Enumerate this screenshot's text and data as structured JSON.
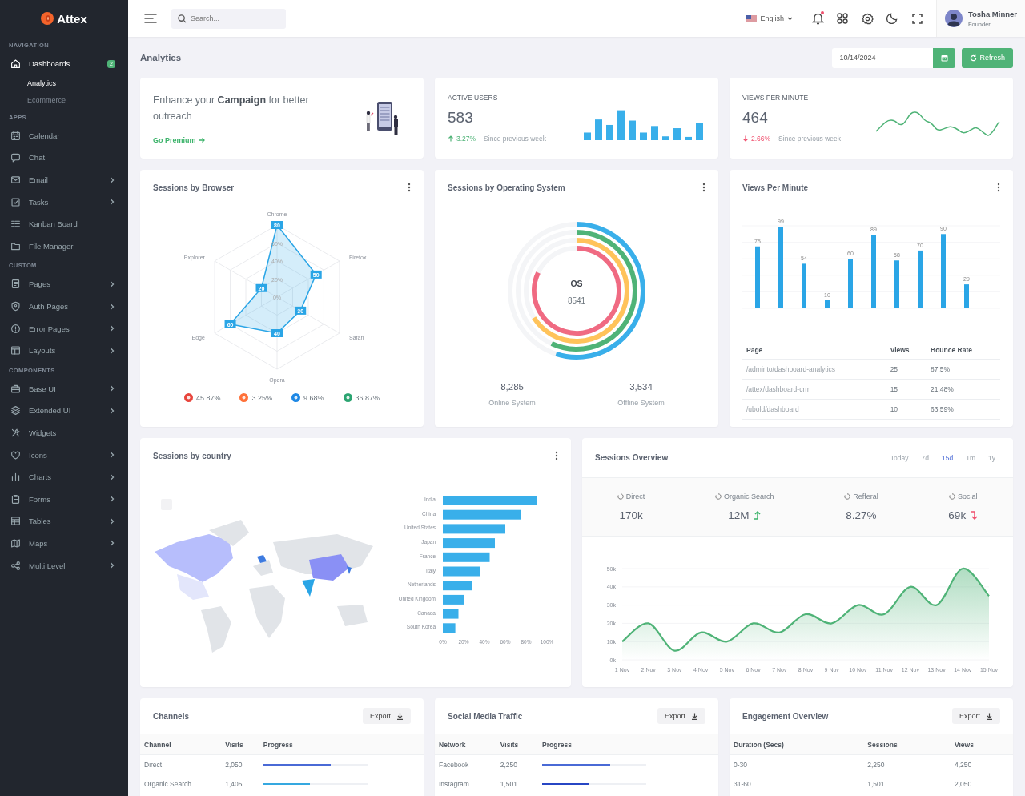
{
  "brand": {
    "name": "Attex"
  },
  "sidebar": {
    "sections": [
      {
        "title": "NAVIGATION",
        "items": [
          {
            "label": "Dashboards",
            "kind": "menu",
            "expanded": true,
            "badge": "2",
            "children": [
              {
                "label": "Analytics",
                "selected": true
              },
              {
                "label": "Ecommerce",
                "selected": false
              }
            ]
          }
        ]
      },
      {
        "title": "APPS",
        "items": [
          {
            "label": "Calendar",
            "kind": "link"
          },
          {
            "label": "Chat",
            "kind": "link"
          },
          {
            "label": "Email",
            "kind": "menu",
            "expanded": false
          },
          {
            "label": "Tasks",
            "kind": "menu",
            "expanded": false
          },
          {
            "label": "Kanban Board",
            "kind": "link"
          },
          {
            "label": "File Manager",
            "kind": "link"
          }
        ]
      },
      {
        "title": "CUSTOM",
        "items": [
          {
            "label": "Pages",
            "kind": "menu",
            "expanded": false
          },
          {
            "label": "Auth Pages",
            "kind": "menu",
            "expanded": false
          },
          {
            "label": "Error Pages",
            "kind": "menu",
            "expanded": false
          },
          {
            "label": "Layouts",
            "kind": "menu",
            "expanded": false
          }
        ]
      },
      {
        "title": "COMPONENTS",
        "items": [
          {
            "label": "Base UI",
            "kind": "menu",
            "expanded": false
          },
          {
            "label": "Extended UI",
            "kind": "menu",
            "expanded": false
          },
          {
            "label": "Widgets",
            "kind": "link"
          },
          {
            "label": "Icons",
            "kind": "menu",
            "expanded": false
          },
          {
            "label": "Charts",
            "kind": "menu",
            "expanded": false
          },
          {
            "label": "Forms",
            "kind": "menu",
            "expanded": false
          },
          {
            "label": "Tables",
            "kind": "menu",
            "expanded": false
          },
          {
            "label": "Maps",
            "kind": "menu",
            "expanded": false
          },
          {
            "label": "Multi Level",
            "kind": "menu",
            "expanded": false
          }
        ]
      }
    ]
  },
  "topbar": {
    "search": {
      "placeholder": "Search..."
    },
    "language": "English",
    "notifications": {
      "unread": true
    },
    "user": {
      "name": "Tosha Minner",
      "role": "Founder"
    }
  },
  "page": {
    "title": "Analytics",
    "date": "10/14/2024",
    "refresh": "Refresh"
  },
  "promo": {
    "text": "Enhance your **Campaign** for better outreach",
    "link": "Go Premium"
  },
  "stats": [
    {
      "kind": "bars",
      "title": "ACTIVE USERS",
      "value": "583",
      "change": "3.27%",
      "rising": true,
      "note": "Since previous week"
    },
    {
      "kind": "wave",
      "title": "VIEWS PER MINUTE",
      "value": "464",
      "change": "2.66%",
      "rising": false,
      "note": "Since previous week"
    }
  ],
  "browser_card": {
    "title": "Sessions by Browser",
    "radar": {
      "axes": [
        {
          "label": "Chrome",
          "value": "80"
        },
        {
          "label": "Explorer",
          "value": "20"
        },
        {
          "label": "Firefox",
          "value": "50"
        },
        {
          "label": "Edge",
          "value": "60"
        },
        {
          "label": "Safari",
          "value": "30"
        },
        {
          "label": "Opera",
          "value": "40"
        }
      ],
      "ticks": [
        "60%",
        "40%",
        "20%",
        "0%"
      ]
    },
    "legend": [
      {
        "value": "45.87%",
        "color": "#e8453c"
      },
      {
        "value": "3.25%",
        "color": "#ff7139"
      },
      {
        "value": "9.68%",
        "color": "#1e88e5"
      },
      {
        "value": "36.87%",
        "color": "#2ba471"
      }
    ]
  },
  "os_card": {
    "title": "Sessions by Operating System",
    "center_label": "OS",
    "center_value": "8541",
    "totals": [
      {
        "value": "8,285",
        "label": "Online System"
      },
      {
        "value": "3,534",
        "label": "Offline System"
      }
    ]
  },
  "views_card": {
    "title": "Views Per Minute",
    "bar_labels": [
      "75",
      "99",
      "54",
      "10",
      "60",
      "89",
      "58",
      "70",
      "90",
      "29"
    ],
    "table": {
      "columns": [
        "Page",
        "Views",
        "Bounce Rate"
      ],
      "rows": [
        [
          "/adminto/dashboard-analytics",
          "25",
          "87.5%"
        ],
        [
          "/attex/dashboard-crm",
          "15",
          "21.48%"
        ],
        [
          "/ubold/dashboard",
          "10",
          "63.59%"
        ]
      ]
    }
  },
  "country_card": {
    "title": "Sessions by country",
    "zoom_out": "-",
    "chart_data": {
      "type": "bar",
      "orientation": "horizontal",
      "categories": [
        "India",
        "China",
        "United States",
        "Japan",
        "France",
        "Italy",
        "Netherlands",
        "United Kingdom",
        "Canada",
        "South Korea"
      ],
      "values": [
        90,
        75,
        60,
        50,
        45,
        36,
        28,
        20,
        15,
        12
      ],
      "xlim": [
        0,
        100
      ],
      "xticks": [
        {
          "value": 0,
          "label": "0%"
        },
        {
          "value": 20,
          "label": "20%"
        },
        {
          "value": 40,
          "label": "40%"
        },
        {
          "value": 60,
          "label": "60%"
        },
        {
          "value": 80,
          "label": "80%"
        },
        {
          "value": 100,
          "label": "100%"
        }
      ]
    }
  },
  "overview_card": {
    "title": "Sessions Overview",
    "ranges": [
      {
        "label": "Today",
        "selected": false
      },
      {
        "label": "7d",
        "selected": false
      },
      {
        "label": "15d",
        "selected": true
      },
      {
        "label": "1m",
        "selected": false
      },
      {
        "label": "1y",
        "selected": false
      }
    ],
    "metrics": [
      {
        "label": "Direct",
        "value": "170k",
        "kind": "plain"
      },
      {
        "label": "Organic Search",
        "value": "12M",
        "kind": "rising"
      },
      {
        "label": "Refferal",
        "value": "8.27%",
        "kind": "plain"
      },
      {
        "label": "Social",
        "value": "69k",
        "kind": "falling"
      }
    ],
    "chart_data": {
      "type": "area",
      "categories": [
        "1 Nov",
        "2 Nov",
        "3 Nov",
        "4 Nov",
        "5 Nov",
        "6 Nov",
        "7 Nov",
        "8 Nov",
        "9 Nov",
        "10 Nov",
        "11 Nov",
        "12 Nov",
        "13 Nov",
        "14 Nov",
        "15 Nov"
      ],
      "values": [
        10000,
        20000,
        5000,
        15000,
        10000,
        20000,
        15000,
        25000,
        20000,
        30000,
        25000,
        40000,
        30000,
        50000,
        35000
      ],
      "grid": true,
      "ylim": [
        0,
        50000
      ],
      "yticks": [
        {
          "value": 0,
          "label": "0k"
        },
        {
          "value": 10000,
          "label": "10k"
        },
        {
          "value": 20000,
          "label": "20k"
        },
        {
          "value": 30000,
          "label": "30k"
        },
        {
          "value": 40000,
          "label": "40k"
        },
        {
          "value": 50000,
          "label": "50k"
        }
      ]
    }
  },
  "tables": [
    {
      "title": "Channels",
      "export": "Export",
      "columns": [
        {
          "label": "Channel",
          "kind": "text"
        },
        {
          "label": "Visits",
          "kind": "text"
        },
        {
          "label": "Progress",
          "kind": "progress"
        }
      ],
      "rows": [
        {
          "cells": [
            "Direct",
            "2,050"
          ],
          "level": 0.65,
          "color": "#4a6ad6"
        },
        {
          "cells": [
            "Organic Search",
            "1,405"
          ],
          "level": 0.45,
          "color": "#35a8e0"
        }
      ]
    },
    {
      "title": "Social Media Traffic",
      "export": "Export",
      "columns": [
        {
          "label": "Network",
          "kind": "text"
        },
        {
          "label": "Visits",
          "kind": "text"
        },
        {
          "label": "Progress",
          "kind": "progress"
        }
      ],
      "rows": [
        {
          "cells": [
            "Facebook",
            "2,250"
          ],
          "level": 0.65,
          "color": "#4a6ad6"
        },
        {
          "cells": [
            "Instagram",
            "1,501"
          ],
          "level": 0.45,
          "color": "#2746c4"
        }
      ]
    },
    {
      "title": "Engagement Overview",
      "export": "Export",
      "columns": [
        {
          "label": "Duration (Secs)",
          "kind": "text"
        },
        {
          "label": "Sessions",
          "kind": "text"
        },
        {
          "label": "Views",
          "kind": "text"
        }
      ],
      "rows": [
        {
          "cells": [
            "0-30",
            "2,250",
            "4,250"
          ]
        },
        {
          "cells": [
            "31-60",
            "1,501",
            "2,050"
          ]
        }
      ]
    }
  ]
}
